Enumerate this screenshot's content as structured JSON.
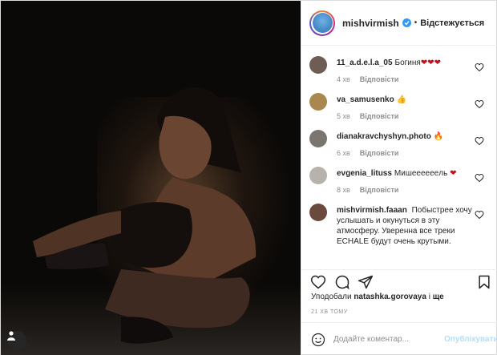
{
  "post": {
    "author": "mishvirmish",
    "verified_icon": "verified-badge-icon",
    "separator": "•",
    "follow_state": "Відстежується"
  },
  "comments": [
    {
      "user": "11_a.d.e.l.a_05",
      "text": "Богиня",
      "emoji": "❤❤❤",
      "age": "4 хв",
      "reply": "Відповісти",
      "avatar_color": "#6e5d53"
    },
    {
      "user": "va_samusenko",
      "text": "",
      "emoji": "👍",
      "age": "5 хв",
      "reply": "Відповісти",
      "avatar_color": "#a9874f"
    },
    {
      "user": "dianakravchyshyn.photo",
      "text": "",
      "emoji": "🔥",
      "age": "6 хв",
      "reply": "Відповісти",
      "avatar_color": "#7b7570"
    },
    {
      "user": "evgenia_lituss",
      "text": "Мишеееееeль",
      "emoji": "❤",
      "age": "8 хв",
      "reply": "Відповісти",
      "avatar_color": "#b8b2ac"
    },
    {
      "user": "mishvirmish.faaan",
      "text": "Побыстрее хочу услышать и окунуться в эту атмосферу. Уверенна все треки ECHALE будут очень крутыми.",
      "emoji": "",
      "age": "",
      "reply": "",
      "avatar_color": "#6a4a3c"
    }
  ],
  "likes": {
    "prefix": "Уподобали",
    "user": "natashka.gorovaya",
    "mid": "і",
    "more": "ще"
  },
  "timestamp": "21 ХВ ТОМУ",
  "comment_box": {
    "placeholder": "Додайте коментар...",
    "publish": "Опублікувати"
  }
}
